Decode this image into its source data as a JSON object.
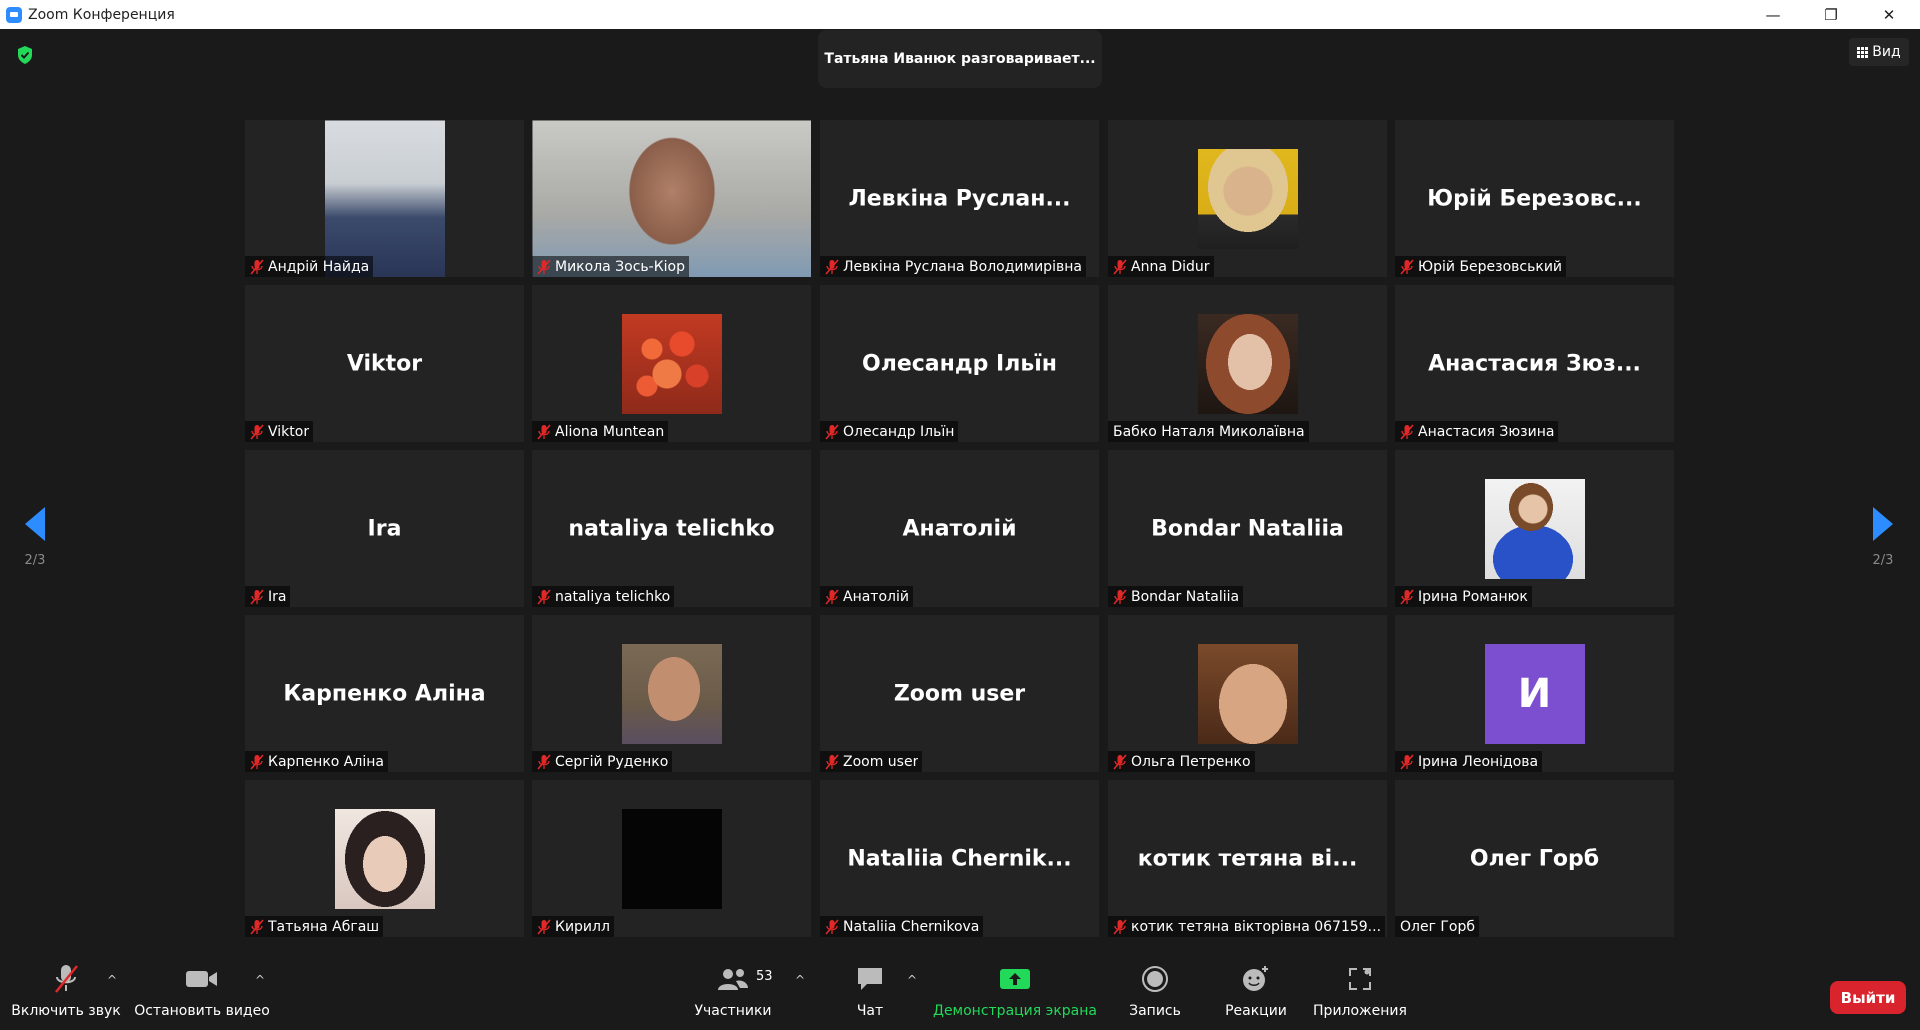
{
  "window": {
    "title": "Zoom Конференция",
    "controls": {
      "minimize": "—",
      "restore": "❐",
      "close": "✕"
    }
  },
  "header": {
    "speaker_text": "Татьяна Иванюк разговаривает...",
    "view_label": "Вид"
  },
  "pagination": {
    "left_page": "2/3",
    "right_page": "2/3"
  },
  "colors": {
    "accent": "#2d8cff",
    "muted_mic": "#e02828",
    "green": "#23d959",
    "exit": "#d9232d"
  },
  "participants": [
    {
      "name": "Андрій Найда",
      "big": "",
      "photo": "man-suit",
      "muted": true
    },
    {
      "name": "Микола Зось-Кіор",
      "big": "",
      "photo": "man-beard",
      "muted": true
    },
    {
      "name": "Левкіна Руслана Володимирівна",
      "big": "Левкіна Руслан...",
      "photo": "",
      "muted": true
    },
    {
      "name": "Anna Didur",
      "big": "",
      "photo": "woman-yellow",
      "muted": true
    },
    {
      "name": "Юрій Березовський",
      "big": "Юрій Березовс...",
      "photo": "",
      "muted": true
    },
    {
      "name": "Viktor",
      "big": "Viktor",
      "photo": "",
      "muted": true
    },
    {
      "name": "Aliona Muntean",
      "big": "",
      "photo": "flowers",
      "muted": true
    },
    {
      "name": "Олесандр Ільїн",
      "big": "Олесандр Ільїн",
      "photo": "",
      "muted": true
    },
    {
      "name": "Бабко Наталя Миколаївна",
      "big": "",
      "photo": "woman-redhair",
      "muted": false
    },
    {
      "name": "Анастасия Зюзина",
      "big": "Анастасия Зюз...",
      "photo": "",
      "muted": true
    },
    {
      "name": "Ira",
      "big": "Ira",
      "photo": "",
      "muted": true
    },
    {
      "name": "nataliya telichko",
      "big": "nataliya telichko",
      "photo": "",
      "muted": true
    },
    {
      "name": "Анатолій",
      "big": "Анатолій",
      "photo": "",
      "muted": true
    },
    {
      "name": "Bondar Nataliia",
      "big": "Bondar Nataliia",
      "photo": "",
      "muted": true
    },
    {
      "name": "Ірина Романюк",
      "big": "",
      "photo": "woman-blue",
      "muted": true
    },
    {
      "name": "Карпенко Аліна",
      "big": "Карпенко Аліна",
      "photo": "",
      "muted": true
    },
    {
      "name": "Сергій Руденко",
      "big": "",
      "photo": "man-glasses",
      "muted": true
    },
    {
      "name": "Zoom user",
      "big": "Zoom user",
      "photo": "",
      "muted": true
    },
    {
      "name": "Ольга Петренко",
      "big": "",
      "photo": "woman-closeup",
      "muted": true
    },
    {
      "name": "Ірина Леонідова",
      "big": "",
      "photo": "initial",
      "initial": "И",
      "muted": true
    },
    {
      "name": "Татьяна Абгаш",
      "big": "",
      "photo": "woman-glasses",
      "muted": true
    },
    {
      "name": "Кирилл",
      "big": "",
      "photo": "black",
      "muted": true
    },
    {
      "name": "Nataliia Chernikova",
      "big": "Nataliia  Chernik...",
      "photo": "",
      "muted": true
    },
    {
      "name": "котик тетяна вікторівна  067159...",
      "big": "котик тетяна ві...",
      "photo": "",
      "muted": true
    },
    {
      "name": "Олег Горб",
      "big": "Олег Горб",
      "photo": "",
      "muted": false
    }
  ],
  "toolbar": {
    "unmute_label": "Включить звук",
    "stop_video_label": "Остановить видео",
    "participants_label": "Участники",
    "participants_count": "53",
    "chat_label": "Чат",
    "share_label": "Демонстрация экрана",
    "record_label": "Запись",
    "reactions_label": "Реакции",
    "apps_label": "Приложения",
    "exit_label": "Выйти",
    "caret": "^"
  }
}
